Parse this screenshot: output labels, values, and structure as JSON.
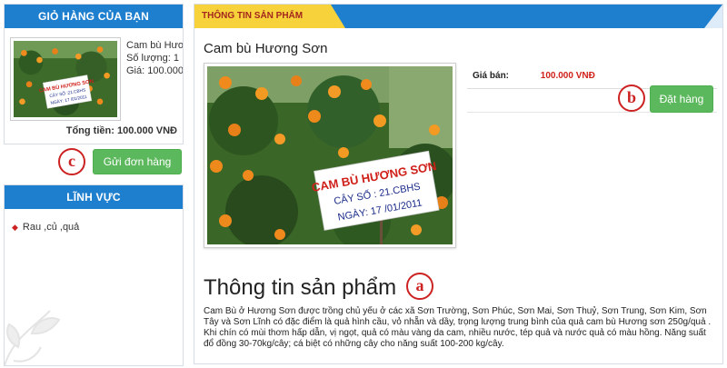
{
  "cart": {
    "header": "GIỎ HÀNG CỦA BẠN",
    "item_name": "Cam bù Hươ",
    "item_qty": "Số lượng: 1",
    "item_price": "Giá: 100.000",
    "total_label": "Tổng tiền:",
    "total_value": "100.000 VNĐ",
    "send_button": "Gửi đơn hàng",
    "annotation": "c"
  },
  "fields": {
    "header": "LĨNH VỰC",
    "items": [
      {
        "label": "Rau ,củ ,quả"
      }
    ]
  },
  "product": {
    "tab_label": "THÔNG TIN SẢN PHẨM",
    "name": "Cam bù Hương Sơn",
    "price_label": "Giá bán:",
    "price_value": "100.000 VNĐ",
    "order_button": "Đặt hàng",
    "order_annotation": "b",
    "section_title": "Thông tin sản phẩm",
    "section_annotation": "a",
    "description": "Cam Bù ở Hương Sơn được trồng chủ yếu ở các xã Sơn Trường, Sơn Phúc, Sơn Mai, Sơn Thuỷ, Sơn Trung, Sơn Kim, Sơn Tây và Sơn Lĩnh có đặc điểm là quả hình cầu, vỏ nhẵn và dầy, trọng lượng trung bình của quả cam bù Hương sơn 250g/quả . Khi chín có mùi thơm hấp dẫn, vị ngọt, quả có màu vàng da cam, nhiều nước, tép quả và nước quả có màu hồng. Năng suất đổ đồng 30-70kg/cây; cá biệt có những cây cho năng suất 100-200 kg/cây.",
    "sign": {
      "line1": "CAM BÙ HƯƠNG SƠN",
      "line2": "CÂY SỐ : 21.CBHS",
      "line3": "NGÀY: 17 /01/2011"
    }
  },
  "colors": {
    "header_blue": "#1f7fcf",
    "tab_yellow": "#f7d23a",
    "button_green": "#5cb85c",
    "price_red": "#d0201a",
    "annotation_red": "#cc2222"
  }
}
